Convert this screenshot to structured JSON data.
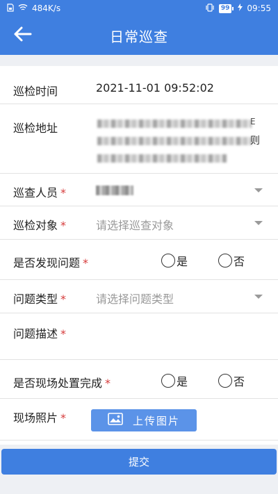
{
  "status_bar": {
    "sim_icon": "sim-card-icon",
    "wifi_icon": "wifi-icon",
    "net_speed": "484K/s",
    "vibrate_icon": "vibrate-icon",
    "battery_level": "99",
    "charging_icon": "lightning-icon",
    "time": "09:55"
  },
  "app_bar": {
    "back_icon": "arrow-left-icon",
    "title": "日常巡查"
  },
  "form": {
    "inspection_time": {
      "label": "巡检时间",
      "value": "2021-11-01 09:52:02"
    },
    "inspection_address": {
      "label": "巡检地址",
      "tail_char_1": "E",
      "tail_char_2": "则"
    },
    "inspector": {
      "label": "巡查人员",
      "required": "*"
    },
    "inspection_target": {
      "label": "巡检对象",
      "required": "*",
      "placeholder": "请选择巡查对象"
    },
    "problem_found": {
      "label": "是否发现问题",
      "required": "*",
      "option_yes": "是",
      "option_no": "否"
    },
    "problem_type": {
      "label": "问题类型",
      "required": "*",
      "placeholder": "请选择问题类型"
    },
    "problem_desc": {
      "label": "问题描述",
      "required": "*"
    },
    "handled_on_site": {
      "label": "是否现场处置完成",
      "required": "*",
      "option_yes": "是",
      "option_no": "否"
    },
    "site_photo": {
      "label": "现场照片",
      "required": "*",
      "upload_label": "上传图片",
      "upload_icon": "image-icon"
    }
  },
  "submit_label": "提交",
  "colors": {
    "primary": "#3f7fe0",
    "upload": "#5b93e8",
    "required": "#d63b3b"
  }
}
